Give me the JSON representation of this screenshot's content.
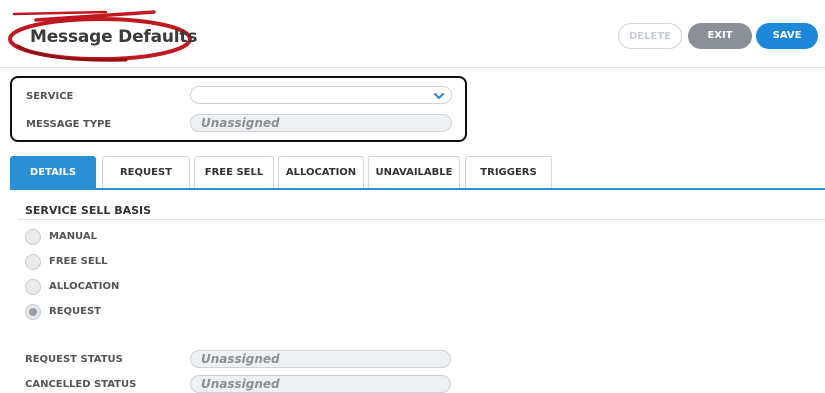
{
  "header": {
    "title": "Message Defaults",
    "buttons": {
      "delete": "DELETE",
      "exit": "EXIT",
      "save": "SAVE"
    }
  },
  "service_box": {
    "service_label": "SERVICE",
    "service_value": "",
    "message_type_label": "MESSAGE TYPE",
    "message_type_value": "Unassigned"
  },
  "tabs": [
    {
      "label": "DETAILS",
      "active": true
    },
    {
      "label": "REQUEST",
      "active": false
    },
    {
      "label": "FREE SELL",
      "active": false
    },
    {
      "label": "ALLOCATION",
      "active": false
    },
    {
      "label": "UNAVAILABLE",
      "active": false
    },
    {
      "label": "TRIGGERS",
      "active": false
    }
  ],
  "details": {
    "section_title": "SERVICE SELL BASIS",
    "options": [
      {
        "label": "MANUAL",
        "selected": false
      },
      {
        "label": "FREE SELL",
        "selected": false
      },
      {
        "label": "ALLOCATION",
        "selected": false
      },
      {
        "label": "REQUEST",
        "selected": true
      }
    ],
    "request_status_label": "REQUEST STATUS",
    "request_status_value": "Unassigned",
    "cancelled_status_label": "CANCELLED STATUS",
    "cancelled_status_value": "Unassigned"
  },
  "colors": {
    "accent": "#2b8fd6",
    "save": "#1d88d9",
    "exit": "#8b9096",
    "annotation": "#c0181f"
  },
  "icons": {
    "service_dropdown": "chevron-down-icon",
    "annotation": "red-ellipse-arrow"
  }
}
